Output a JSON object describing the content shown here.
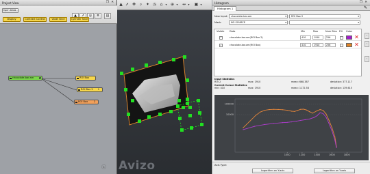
{
  "project_view": {
    "title": "Project View",
    "title_controls": "❐ ✕",
    "open_data_label": "Open Data...",
    "filters": [
      {
        "label": "Display"
      },
      {
        "label": "Contrast Control"
      },
      {
        "label": "Voxel Slice"
      },
      {
        "label": "Cylinder Slice"
      }
    ],
    "tools": [
      {
        "icon": "arrow-select-icon",
        "glyph": "▲"
      },
      {
        "icon": "pointer-icon",
        "glyph": "➚"
      },
      {
        "icon": "eye-icon",
        "glyph": "◎"
      },
      {
        "icon": "tree-view-icon",
        "glyph": "≣"
      },
      {
        "icon": "panel-view-icon",
        "glyph": "▤"
      }
    ],
    "nodes": [
      {
        "label": "chocolate-bar.am",
        "color": "#79d44a"
      },
      {
        "label": "ROI Box",
        "color": "#f6d64b"
      },
      {
        "label": "ROI Box 2",
        "color": "#f6d64b"
      },
      {
        "label": "ROI Box",
        "color": "#f1a05a"
      }
    ],
    "port_numbers": [
      "1",
      "1",
      "1",
      "2"
    ],
    "help_glyph": "ⓒ"
  },
  "viewer": {
    "logo": "Avizo",
    "toolbar_glyphs": [
      "▲",
      "➚",
      "✚",
      "⌕",
      "✦",
      "◷",
      "⌂",
      "▾",
      "⊕",
      "▾",
      "↔",
      "▾",
      "▣",
      "▾"
    ]
  },
  "histogram": {
    "title": "Histogram",
    "title_controls": "❐ ✕",
    "tab": "Histogram 1",
    "edit_glyph": "✎",
    "new_input_label": "New Input:",
    "new_input_value": "chocolate-bar.am",
    "roi_value": "ROI Box 2",
    "mask_label": "Mask:",
    "mask_value": "NO SOURCE",
    "columns": [
      "Visible",
      "Data",
      "Min",
      "Max",
      "Num Bins",
      "Fill",
      "Color"
    ],
    "rows": [
      {
        "visible": "✓",
        "data": "chocolate-bar.am(ROI Box 2)",
        "min": "410",
        "max": "1910",
        "bins": "256",
        "fill": "",
        "color": "#a020c8"
      },
      {
        "visible": "✓",
        "data": "chocolate-bar.am(ROI Box)",
        "min": "410",
        "max": "1910",
        "bins": "256",
        "fill": "",
        "color": "#e08428"
      }
    ],
    "side_buttons": [
      "‹",
      "›",
      "›"
    ],
    "input_stats_title": "Input Statistics",
    "input_stats_line": "ROI 2",
    "input_min": "min: 1910",
    "input_max": "max: 1910",
    "input_mean": "mean: 668.387",
    "input_dev": "deviation: 377.117",
    "cursor_stats_title": "Current Cursor Statistics",
    "cursor_min": "min: 410",
    "cursor_max": "max: 1910",
    "cursor_mean": "mean: 1172.58",
    "cursor_dev": "deviation: 139.615",
    "axis_type_label": "Axis Type:",
    "axis_buttons": [
      "Logarithm on Y-axis",
      "Logarithm on Y-axis"
    ]
  },
  "chart_data": {
    "type": "line",
    "ylabels": [
      "100000",
      "10000"
    ],
    "xlabels": [
      "1000",
      "1200",
      "1400",
      "1600",
      "1800"
    ],
    "series": [
      {
        "color": "#e8873a",
        "x": [
          410,
          500,
          580,
          640,
          700,
          760,
          820,
          880,
          940,
          1000,
          1060,
          1100,
          1140,
          1180,
          1220,
          1260,
          1300,
          1340,
          1400,
          1440,
          1480,
          1520,
          1560,
          1600,
          1640,
          1660
        ],
        "y": [
          600,
          2500,
          9000,
          18000,
          26000,
          30000,
          32000,
          31000,
          29000,
          26000,
          21000,
          20000,
          25000,
          32000,
          33000,
          27000,
          19000,
          14000,
          23000,
          30000,
          26000,
          12000,
          3000,
          600,
          80,
          10
        ]
      },
      {
        "color": "#b03cd0",
        "x": [
          410,
          560,
          700,
          820,
          940,
          1000,
          1060,
          1120,
          1180,
          1240,
          1300,
          1360,
          1400,
          1440,
          1480,
          1520,
          1560,
          1600,
          1640,
          1660
        ],
        "y": [
          400,
          800,
          1200,
          1500,
          1800,
          1900,
          2100,
          2400,
          2900,
          3400,
          3900,
          5500,
          8000,
          15000,
          13000,
          6000,
          1500,
          300,
          40,
          8
        ]
      }
    ],
    "xlim": [
      300,
      2000
    ],
    "yscale": "log",
    "ylim": [
      3,
      300000
    ],
    "grid": true
  }
}
